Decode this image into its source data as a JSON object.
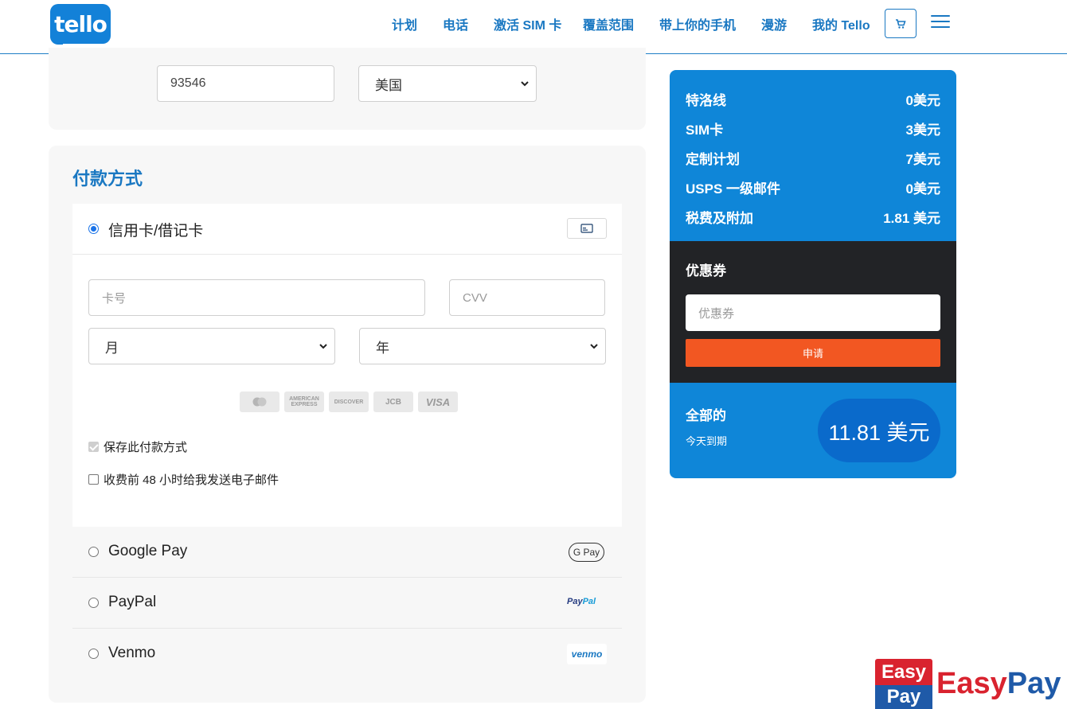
{
  "header": {
    "logo": "tello",
    "nav": [
      "计划",
      "电话",
      "激活 SIM 卡",
      "覆盖范围",
      "带上你的手机",
      "漫游",
      "我的 Tello"
    ]
  },
  "address": {
    "zip_value": "93546",
    "country_selected": "美国"
  },
  "payment": {
    "title": "付款方式",
    "options": {
      "credit": "信用卡/借记卡",
      "google_pay": "Google Pay",
      "paypal": "PayPal",
      "venmo": "Venmo"
    },
    "card_number_placeholder": "卡号",
    "cvv_placeholder": "CVV",
    "month_selected": "月",
    "year_selected": "年",
    "brands": {
      "amex": "AMERICAN EXPRESS",
      "discover": "DISCOVER",
      "jcb": "JCB",
      "visa": "VISA"
    },
    "save_method": "保存此付款方式",
    "email_notice": "收费前 48 小时给我发送电子邮件",
    "logos": {
      "gpay": "G Pay",
      "paypal_a": "Pay",
      "paypal_b": "Pal",
      "venmo": "venmo"
    }
  },
  "summary": {
    "items": [
      {
        "label": "特洛线",
        "price": "0美元"
      },
      {
        "label": "SIM卡",
        "price": "3美元"
      },
      {
        "label": "定制计划",
        "price": "7美元"
      },
      {
        "label": "USPS 一级邮件",
        "price": "0美元"
      },
      {
        "label": "税费及附加",
        "price": "1.81 美元"
      }
    ],
    "coupon_title": "优惠券",
    "coupon_placeholder": "优惠券",
    "apply_label": "申请",
    "total_label": "全部的",
    "total_sub": "今天到期",
    "total_value": "11.81 美元"
  },
  "watermark": {
    "box_top": "Easy",
    "box_bottom": "Pay",
    "text_a": "Easy",
    "text_b": "Pay"
  },
  "colors": {
    "brand_blue": "#1381d8",
    "summary_blue": "#0f86d8",
    "apply_orange": "#f25722",
    "dark_panel": "#222326"
  }
}
